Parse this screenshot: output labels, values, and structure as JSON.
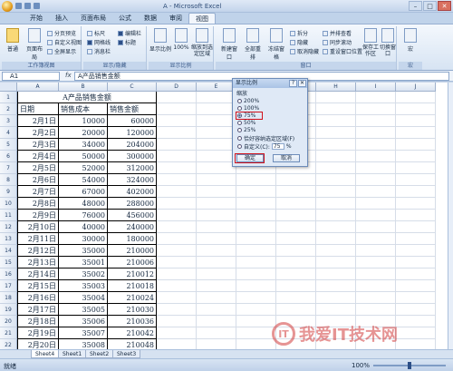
{
  "window": {
    "title": "A - Microsoft Excel",
    "min": "–",
    "max": "□",
    "close": "✕"
  },
  "tabs": [
    "开始",
    "插入",
    "页面布局",
    "公式",
    "数据",
    "审阅",
    "视图"
  ],
  "ribbon": {
    "groups": {
      "workbook_views": "工作簿视图",
      "show_hide": "显示/隐藏",
      "zoom": "显示比例",
      "window": "窗口",
      "macros": "宏"
    },
    "buttons": {
      "normal": "普通",
      "page_layout": "页面布局",
      "page_break": "分页预览",
      "custom_views": "自定义视图",
      "full_screen": "全屏显示",
      "ruler": "标尺",
      "gridlines": "网格线",
      "msg_bar": "消息栏",
      "formula_bar": "编辑栏",
      "headings": "标题",
      "zoom": "显示比例",
      "zoom100": "100%",
      "zoom_sel": "缩放到选定区域",
      "new_window": "新建窗口",
      "arrange_all": "全部重排",
      "freeze": "冻结窗格",
      "split": "拆分",
      "hide": "隐藏",
      "unhide": "取消隐藏",
      "side_by_side": "并排查看",
      "sync_scroll": "同步滚动",
      "reset_pos": "重设窗口位置",
      "save_workspace": "保存工作区",
      "switch_window": "切换窗口",
      "macros": "宏"
    }
  },
  "formula_bar": {
    "name_box": "A1",
    "fx": "fx",
    "content": "A产品销售金额"
  },
  "columns": [
    "A",
    "B",
    "C",
    "D",
    "E",
    "F",
    "G",
    "H",
    "I",
    "J"
  ],
  "rows": [
    "1",
    "2",
    "3",
    "4",
    "5",
    "6",
    "7",
    "8",
    "9",
    "10",
    "11",
    "12",
    "13",
    "14",
    "15",
    "16",
    "17",
    "18",
    "19",
    "20",
    "21",
    "22"
  ],
  "table": {
    "title": "A产品销售金额",
    "headers": [
      "日期",
      "销售成本",
      "销售金额"
    ],
    "data": [
      [
        "2月1日",
        "10000",
        "60000"
      ],
      [
        "2月2日",
        "20000",
        "120000"
      ],
      [
        "2月3日",
        "34000",
        "204000"
      ],
      [
        "2月4日",
        "50000",
        "300000"
      ],
      [
        "2月5日",
        "52000",
        "312000"
      ],
      [
        "2月6日",
        "54000",
        "324000"
      ],
      [
        "2月7日",
        "67000",
        "402000"
      ],
      [
        "2月8日",
        "48000",
        "288000"
      ],
      [
        "2月9日",
        "76000",
        "456000"
      ],
      [
        "2月10日",
        "40000",
        "240000"
      ],
      [
        "2月11日",
        "30000",
        "180000"
      ],
      [
        "2月12日",
        "35000",
        "210000"
      ],
      [
        "2月13日",
        "35001",
        "210006"
      ],
      [
        "2月14日",
        "35002",
        "210012"
      ],
      [
        "2月15日",
        "35003",
        "210018"
      ],
      [
        "2月16日",
        "35004",
        "210024"
      ],
      [
        "2月17日",
        "35005",
        "210030"
      ],
      [
        "2月18日",
        "35006",
        "210036"
      ],
      [
        "2月19日",
        "35007",
        "210042"
      ],
      [
        "2月20日",
        "35008",
        "210048"
      ]
    ]
  },
  "sheet_tabs": [
    "Sheet4",
    "Sheet1",
    "Sheet2",
    "Sheet3"
  ],
  "status": {
    "ready": "就绪",
    "zoom": "100%"
  },
  "dialog": {
    "title": "显示比例",
    "help": "?",
    "close": "✕",
    "section": "缩放",
    "options": [
      "200%",
      "100%",
      "75%",
      "50%",
      "25%",
      "恰好容纳选定区域(F)",
      "自定义(C):"
    ],
    "selected_index": 2,
    "custom_value": "75",
    "custom_unit": "%",
    "ok": "确定",
    "cancel": "取消"
  },
  "watermark": {
    "text": "我爱IT技术网",
    "logo": "IT"
  }
}
